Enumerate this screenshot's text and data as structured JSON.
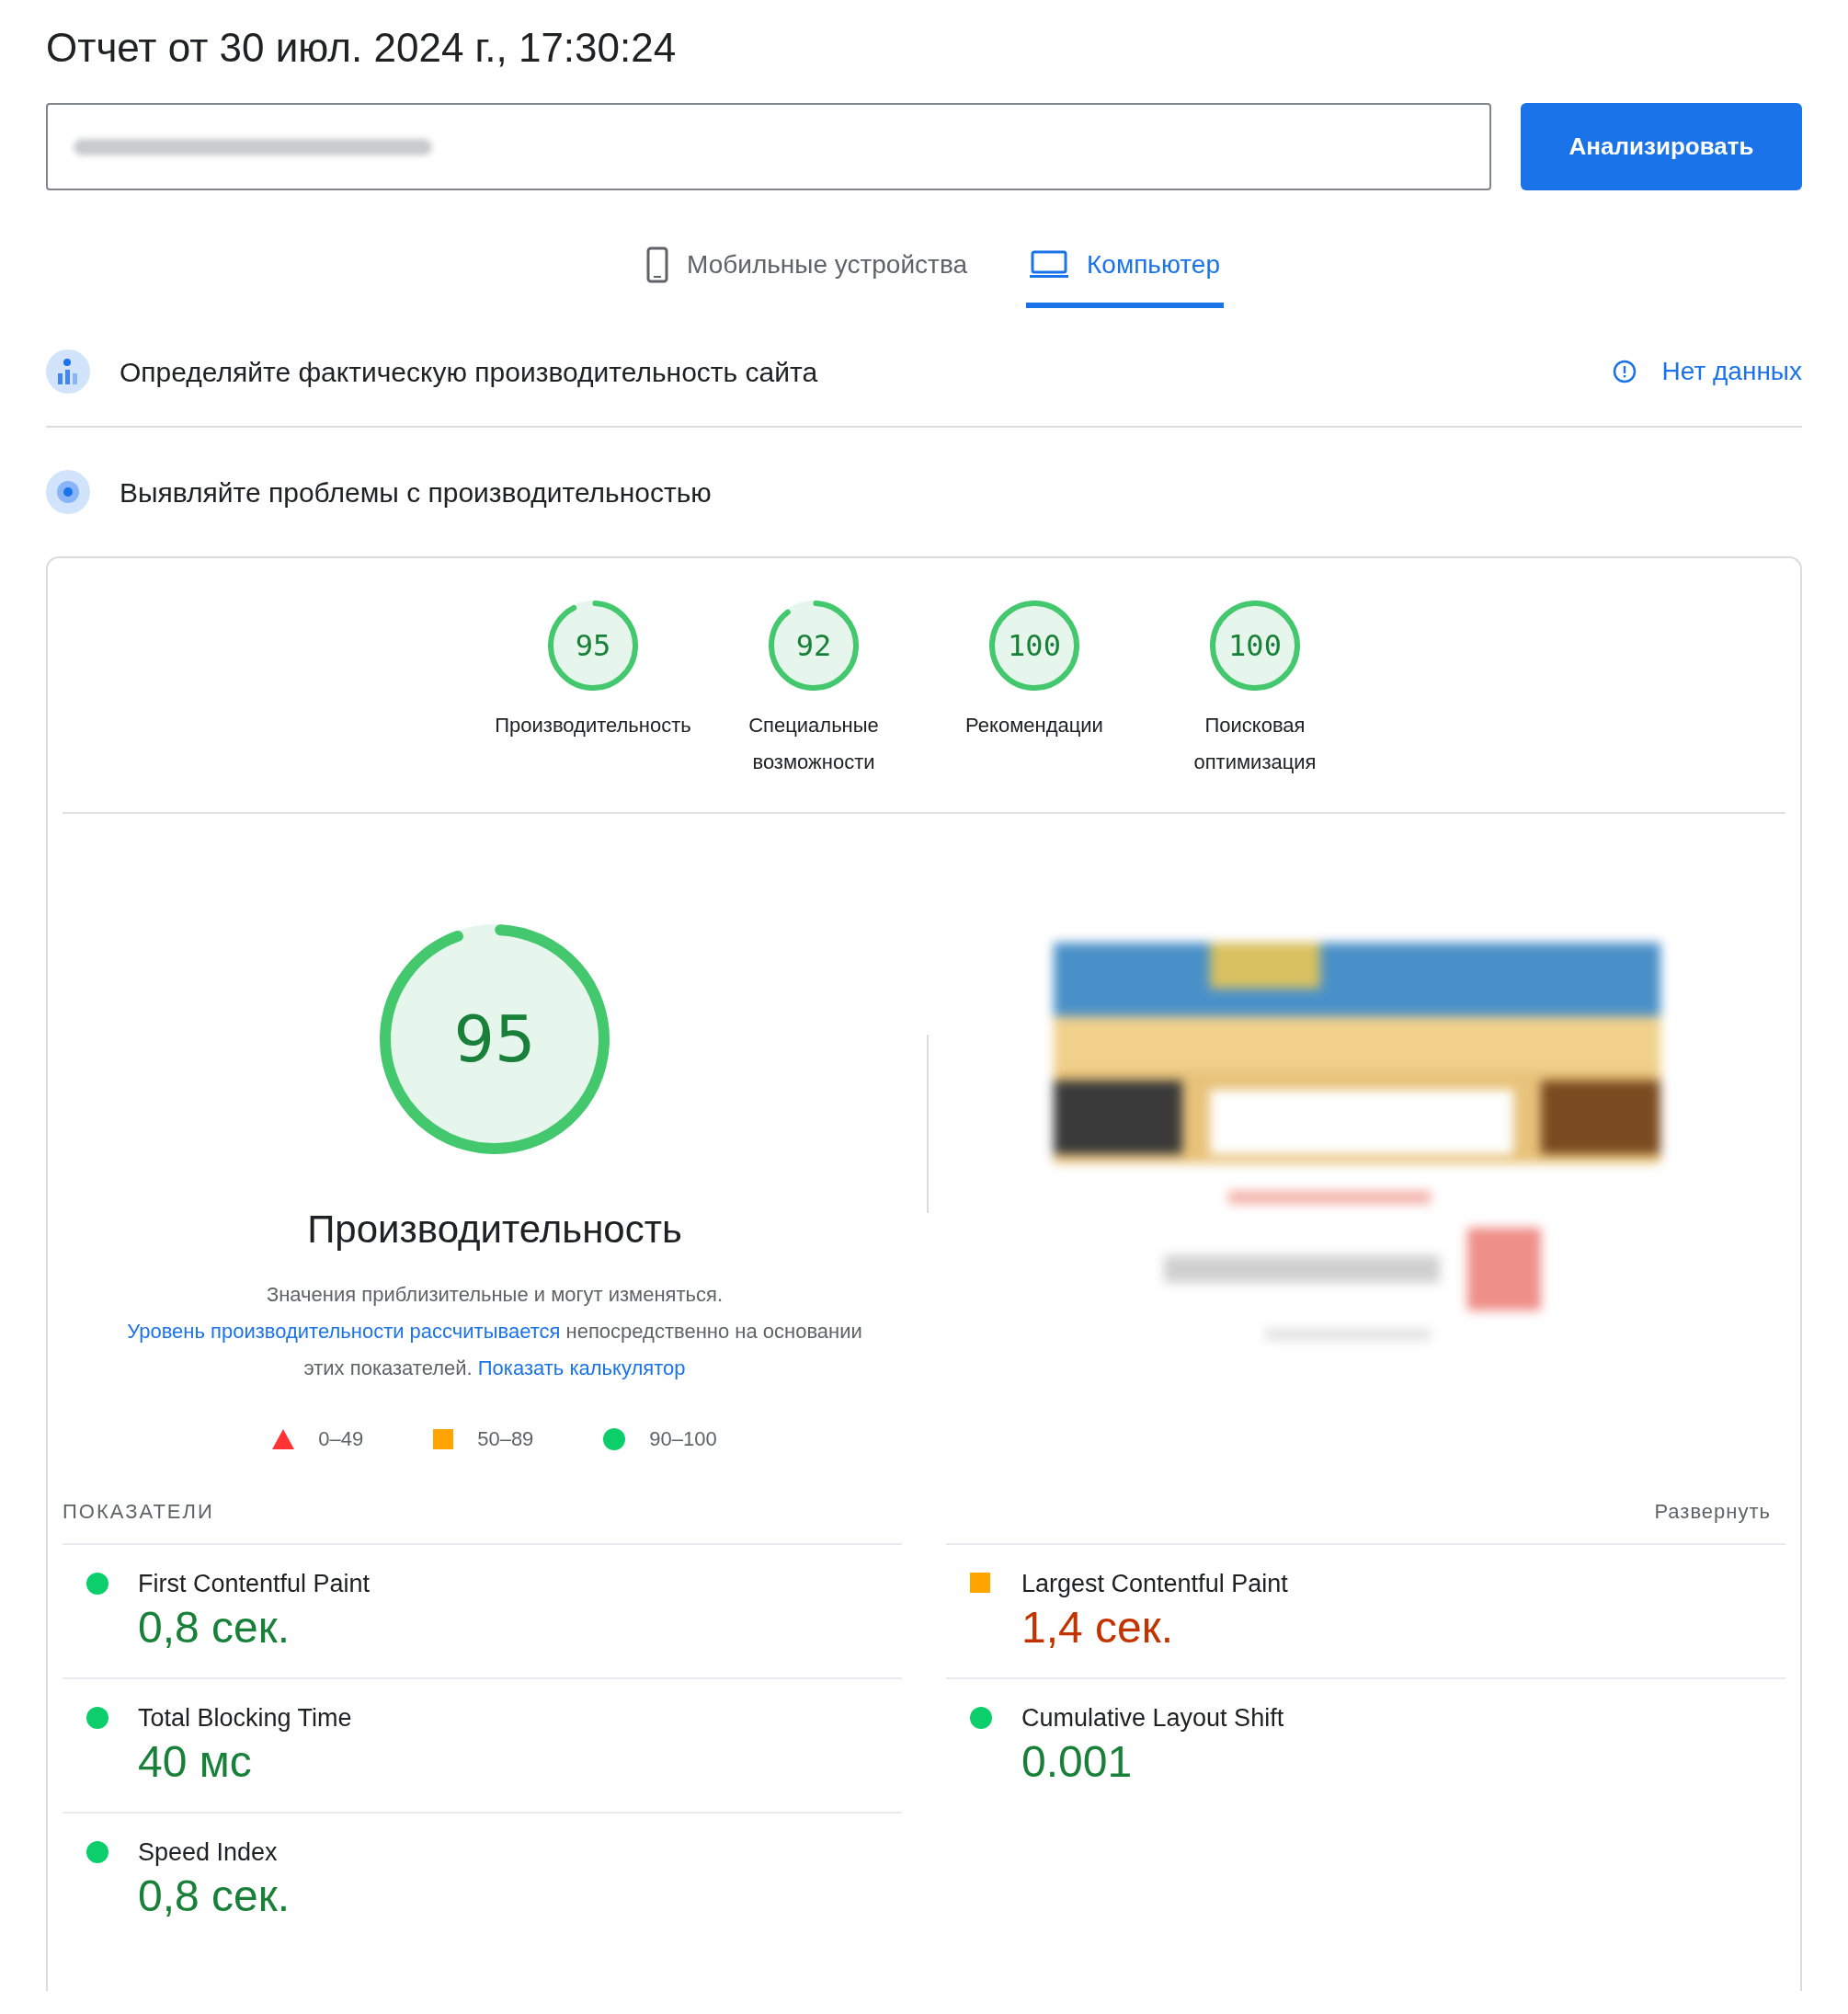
{
  "title": "Отчет от 30 июл. 2024 г., 17:30:24",
  "analyze_button": "Анализировать",
  "tabs": [
    {
      "label": "Мобильные устройства",
      "kind": "phone",
      "selected": false
    },
    {
      "label": "Компьютер",
      "kind": "laptop",
      "selected": true
    }
  ],
  "field_data": {
    "title": "Определяйте фактическую производительность сайта",
    "status": "Нет данных"
  },
  "diagnostics": {
    "title": "Выявляйте проблемы с производительностью"
  },
  "categories": [
    {
      "score": "95",
      "label": "Производительность",
      "level": 0.95
    },
    {
      "score": "92",
      "label": "Специальные возможности",
      "level": 0.92
    },
    {
      "score": "100",
      "label": "Рекомендации",
      "level": 1
    },
    {
      "score": "100",
      "label": "Поисковая оптимизация",
      "level": 1
    }
  ],
  "performance": {
    "score": "95",
    "level": 0.95,
    "title": "Производительность",
    "description": [
      {
        "text": "Значения приблизительные и могут изменяться. ",
        "link": false
      },
      {
        "text": "Уровень производительности рассчитывается",
        "link": true
      },
      {
        "text": " непосредственно на основании этих показателей. ",
        "link": false
      },
      {
        "text": "Показать калькулятор",
        "link": true
      }
    ]
  },
  "legend": [
    {
      "kind": "fail",
      "range": "0–49"
    },
    {
      "kind": "average",
      "range": "50–89"
    },
    {
      "kind": "pass",
      "range": "90–100"
    }
  ],
  "metrics": {
    "heading": "ПОКАЗАТЕЛИ",
    "expand": "Развернуть",
    "items": [
      {
        "name": "First Contentful Paint",
        "value": "0,8 сек.",
        "kind": "pass"
      },
      {
        "name": "Largest Contentful Paint",
        "value": "1,4 сек.",
        "kind": "average"
      },
      {
        "name": "Total Blocking Time",
        "value": "40 мс",
        "kind": "pass"
      },
      {
        "name": "Cumulative Layout Shift",
        "value": "0.001",
        "kind": "pass"
      },
      {
        "name": "Speed Index",
        "value": "0,8 сек.",
        "kind": "pass"
      }
    ]
  }
}
